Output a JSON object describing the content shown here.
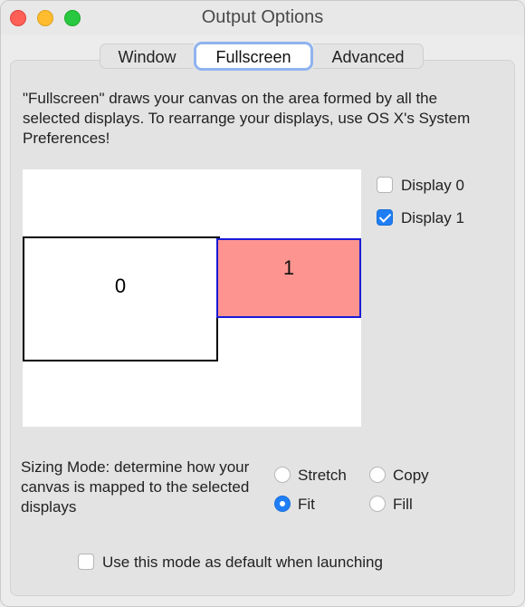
{
  "window": {
    "title": "Output Options"
  },
  "tabs": [
    {
      "label": "Window",
      "selected": false
    },
    {
      "label": "Fullscreen",
      "selected": true
    },
    {
      "label": "Advanced",
      "selected": false
    }
  ],
  "description": "\"Fullscreen\" draws your canvas on the area formed by all the selected displays.  To rearrange your displays, use OS X's System Preferences!",
  "displays": [
    {
      "number": "0",
      "checkbox_label": "Display 0",
      "checked": false
    },
    {
      "number": "1",
      "checkbox_label": "Display 1",
      "checked": true
    }
  ],
  "sizing": {
    "description": "Sizing Mode: determine how your canvas is mapped to the selected displays",
    "options": [
      {
        "label": "Stretch",
        "selected": false
      },
      {
        "label": "Copy",
        "selected": false
      },
      {
        "label": "Fit",
        "selected": true
      },
      {
        "label": "Fill",
        "selected": false
      }
    ]
  },
  "default_checkbox": {
    "label": "Use this mode as default when launching",
    "checked": false
  },
  "colors": {
    "selected_display_fill": "#fe9490",
    "selected_display_border": "#1a1ad6",
    "accent": "#1f7ef5",
    "focus_ring": "#8fb3ef"
  }
}
